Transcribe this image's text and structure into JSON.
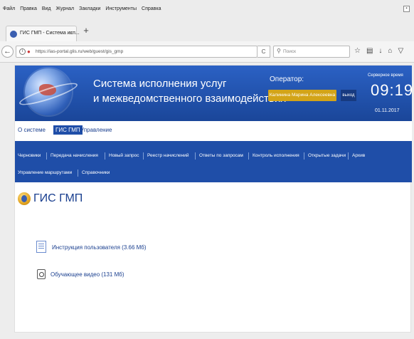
{
  "browser": {
    "menu": [
      "Файл",
      "Правка",
      "Вид",
      "Журнал",
      "Закладки",
      "Инструменты",
      "Справка"
    ],
    "tab_title": "ГИС ГМП - Система исп...",
    "tab_close": "×",
    "new_tab": "+",
    "url": "https://ias-portal.glis.ru/web/guest/gis_gmp",
    "search_placeholder": "Поиск",
    "icons": [
      "star-icon",
      "bookmarks-icon",
      "download-icon",
      "home-icon",
      "pocket-icon"
    ]
  },
  "banner": {
    "title_line1": "Система исполнения услуг",
    "title_line2": "и межведомственного взаимодействия",
    "operator_label": "Оператор:",
    "operator_name": "Калинина Марина Алексеевна",
    "logout": "выход",
    "server_time_label": "Серверное время",
    "time": "09:19",
    "date": "01.11.2017"
  },
  "topnav": {
    "items": [
      {
        "label": "О системе"
      },
      {
        "label": "ГИС ГМП"
      },
      {
        "label": "Управление"
      }
    ]
  },
  "subnav": {
    "row1": [
      "Черновики",
      "Передача начисления",
      "Новый запрос",
      "Реестр начислений",
      "Ответы по запросам",
      "Контроль исполнения",
      "Открытые задачи",
      "Архив"
    ],
    "row2": [
      "Управление маршрутами",
      "Справочники"
    ]
  },
  "content": {
    "heading": "ГИС ГМП",
    "doc_link": "Инструкция пользователя (3.66 Мб)",
    "video_link": "Обучающее видео (131 Мб)"
  },
  "colors": {
    "brand": "#1f4ea8",
    "accent": "#d3a418"
  }
}
